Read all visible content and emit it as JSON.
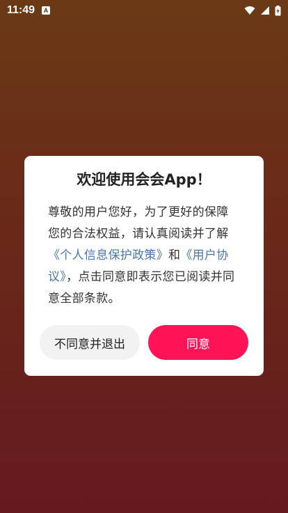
{
  "status_bar": {
    "time": "11:49",
    "notification_glyph": "A",
    "icons": [
      "wifi-icon",
      "signal-icon",
      "battery-charging-icon"
    ]
  },
  "dialog": {
    "title": "欢迎使用会会App！",
    "body_intro": "尊敬的用户您好，为了更好的保障您的合法权益，请认真阅读并了解",
    "privacy_link": "《个人信息保护政策》",
    "conjunction": "和",
    "user_agreement_link": "《用户协议》",
    "body_outro": "，点击同意即表示您已阅读并同意全部条款。",
    "decline_label": "不同意并退出",
    "agree_label": "同意"
  },
  "colors": {
    "accent": "#ff1457",
    "link": "#4a76b0",
    "background_top": "#6a3a16",
    "background_bottom": "#651a20"
  }
}
